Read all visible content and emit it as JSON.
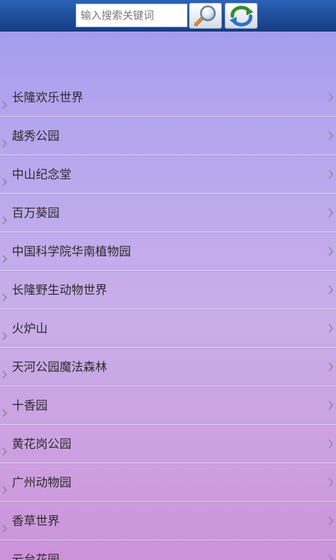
{
  "search": {
    "placeholder": "输入搜索关键词",
    "value": ""
  },
  "icons": {
    "search_button": "magnifier-icon",
    "refresh_button": "refresh-icon"
  },
  "colors": {
    "topbar": "#1f4e9c",
    "list_gradient_top": "#9f97ee",
    "list_gradient_bottom": "#cc92d9",
    "arrow": "#8a8a9a"
  },
  "list": {
    "items": [
      {
        "label": "长隆欢乐世界"
      },
      {
        "label": "越秀公园"
      },
      {
        "label": "中山纪念堂"
      },
      {
        "label": "百万葵园"
      },
      {
        "label": "中国科学院华南植物园"
      },
      {
        "label": "长隆野生动物世界"
      },
      {
        "label": "火炉山"
      },
      {
        "label": "天河公园魔法森林"
      },
      {
        "label": "十香园"
      },
      {
        "label": "黄花岗公园"
      },
      {
        "label": "广州动物园"
      },
      {
        "label": "香草世界"
      },
      {
        "label": "云台花园"
      }
    ]
  }
}
